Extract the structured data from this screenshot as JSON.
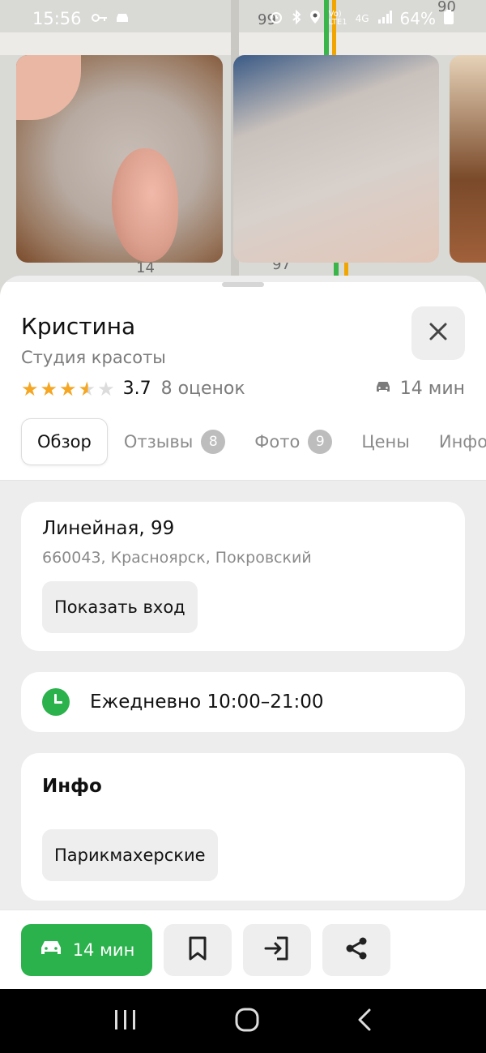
{
  "status_bar": {
    "time": "15:56",
    "battery": "64%",
    "network": "4G"
  },
  "map": {
    "labels": [
      "99",
      "90",
      "14",
      "97"
    ]
  },
  "place": {
    "name": "Кристина",
    "category": "Студия красоты",
    "rating": "3.7",
    "rating_value": 3.7,
    "reviews_count_label": "8 оценок",
    "eta": "14 мин"
  },
  "tabs": [
    {
      "label": "Обзор",
      "active": true
    },
    {
      "label": "Отзывы",
      "badge": "8"
    },
    {
      "label": "Фото",
      "badge": "9"
    },
    {
      "label": "Цены"
    },
    {
      "label": "Инфо"
    }
  ],
  "address": {
    "street": "Линейная, 99",
    "details": "660043, Красноярск, Покровский",
    "show_entrance_label": "Показать вход"
  },
  "hours": {
    "text": "Ежедневно 10:00–21:00"
  },
  "info": {
    "title": "Инфо",
    "chip": "Парикмахерские"
  },
  "actions": {
    "route_label": "14 мин",
    "icons": [
      "bookmark-icon",
      "entrance-icon",
      "share-icon"
    ]
  },
  "colors": {
    "accent_green": "#2bb24c",
    "star": "#f5a623"
  }
}
